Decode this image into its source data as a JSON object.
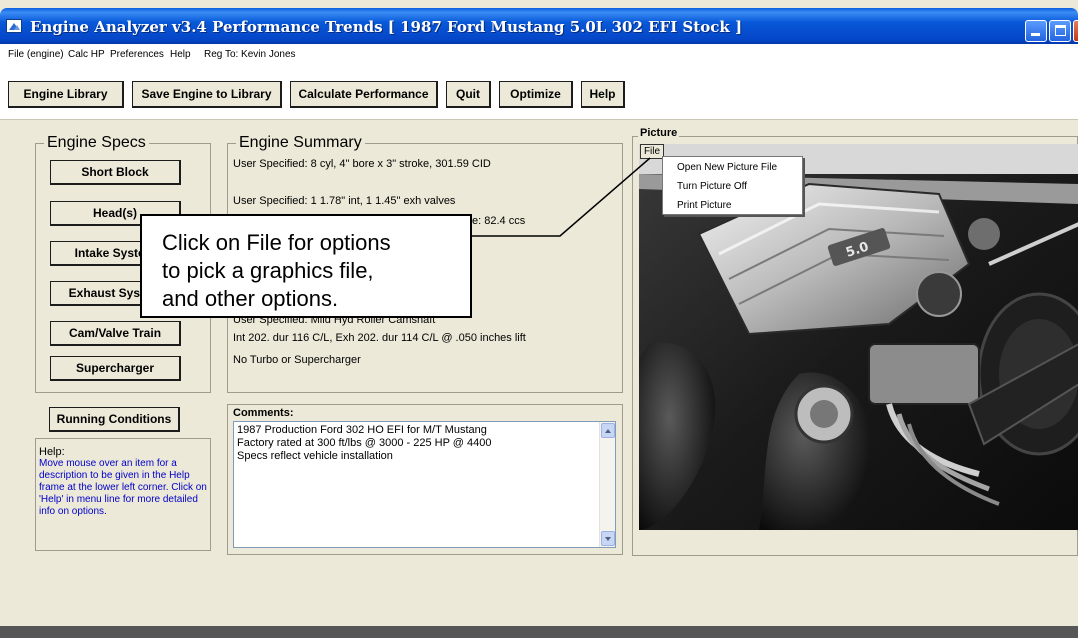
{
  "window": {
    "title": "Engine Analyzer v3.4  Performance Trends  [ 1987 Ford Mustang 5.0L 302 EFI Stock ]"
  },
  "menu": {
    "items": [
      "File (engine)",
      "Calc HP",
      "Preferences",
      "Help",
      "Reg To: Kevin Jones"
    ]
  },
  "toolbar": {
    "buttons": [
      "Engine Library",
      "Save Engine to Library",
      "Calculate Performance",
      "Quit",
      "Optimize",
      "Help"
    ]
  },
  "engine_specs": {
    "title": "Engine Specs",
    "buttons": [
      "Short Block",
      "Head(s)",
      "Intake System",
      "Exhaust System",
      "Cam/Valve Train",
      "Supercharger"
    ]
  },
  "running_conditions": {
    "label": "Running Conditions"
  },
  "help": {
    "title": "Help:",
    "text": "Move mouse over an item for a description to be given in the Help frame at the lower left corner. Click on 'Help' in menu line for more detailed info on options."
  },
  "engine_summary": {
    "title": "Engine Summary",
    "lines": [
      "User Specified: 8 cyl, 4\" bore x 3\" stroke, 301.59 CID",
      "User Specified:  1  1.78\" int,  1  1.45\" exh valves",
      "e: 82.4 ccs",
      "User Specified:  Mild Hyd Roller Camshaft",
      "Int 202. dur 116 C/L,   Exh 202. dur 114 C/L  @ .050 inches lift",
      "No Turbo or Supercharger"
    ]
  },
  "comments": {
    "title": "Comments:",
    "lines": [
      "1987 Production Ford 302 HO EFI for M/T Mustang",
      "Factory rated at 300 ft/lbs @ 3000 - 225 HP @ 4400",
      "Specs reflect vehicle installation"
    ]
  },
  "picture": {
    "title": "Picture",
    "file_button": "File",
    "menu_items": [
      "Open New Picture File",
      "Turn Picture Off",
      "Print Picture"
    ],
    "photo_badge": "5.0"
  },
  "callout": {
    "lines": [
      "Click on File for options",
      "to pick a graphics file,",
      "and other options."
    ]
  },
  "colors": {
    "titlebar": "#0546c8",
    "window_face": "#ece9d8",
    "help_text": "#0000cc"
  }
}
